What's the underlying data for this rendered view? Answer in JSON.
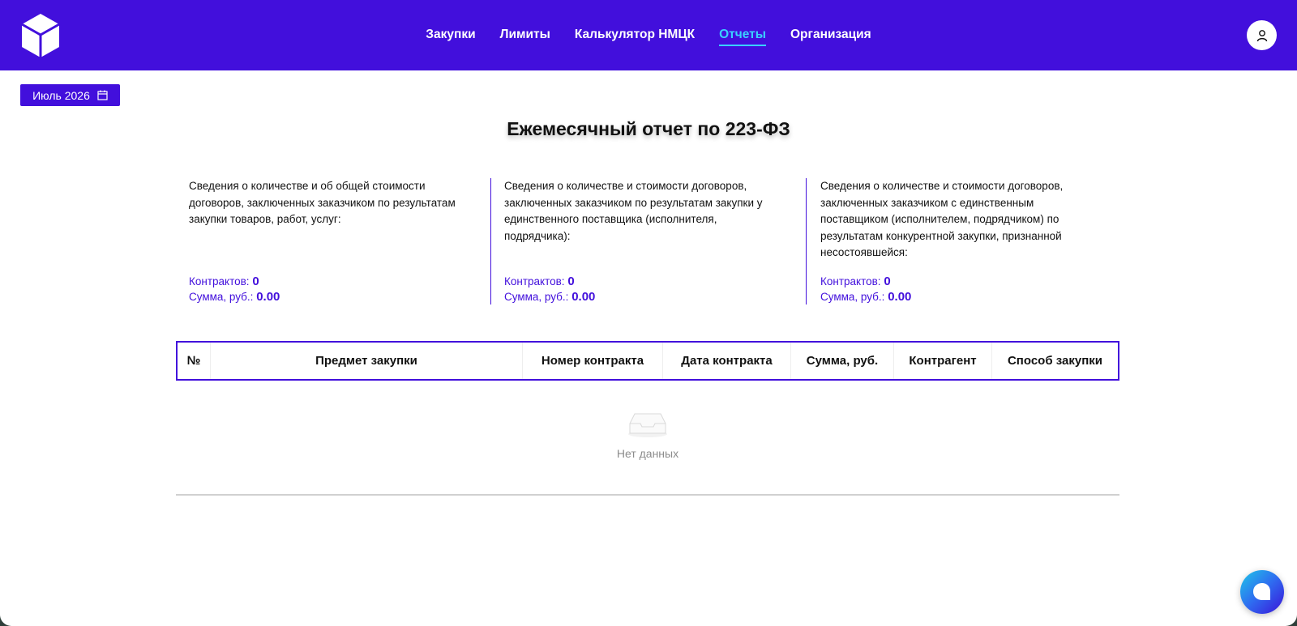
{
  "nav": {
    "items": [
      {
        "label": "Закупки"
      },
      {
        "label": "Лимиты"
      },
      {
        "label": "Калькулятор НМЦК"
      },
      {
        "label": "Отчеты"
      },
      {
        "label": "Организация"
      }
    ],
    "active_index": 3
  },
  "date_picker": {
    "value": "Июль 2026",
    "icon": "calendar-icon"
  },
  "page_title": "Ежемесячный отчет по 223-ФЗ",
  "stats": [
    {
      "description": "Сведения о количестве и об общей стоимости договоров, заключенных заказчиком по результатам закупки товаров, работ, услуг:",
      "contracts_label": "Контрактов:",
      "contracts_value": "0",
      "sum_label": "Сумма, руб.:",
      "sum_value": "0.00"
    },
    {
      "description": "Сведения о количестве и стоимости договоров, заключенных заказчиком по результатам закупки у единственного поставщика (исполнителя, подрядчика):",
      "contracts_label": "Контрактов:",
      "contracts_value": "0",
      "sum_label": "Сумма, руб.:",
      "sum_value": "0.00"
    },
    {
      "description": "Сведения о количестве и стоимости договоров, заключенных заказчиком с единственным поставщиком (исполнителем, подрядчиком) по результатам конкурентной закупки, признанной несостоявшейся:",
      "contracts_label": "Контрактов:",
      "contracts_value": "0",
      "sum_label": "Сумма, руб.:",
      "sum_value": "0.00"
    }
  ],
  "table": {
    "columns": [
      "№",
      "Предмет закупки",
      "Номер контракта",
      "Дата контракта",
      "Сумма, руб.",
      "Контрагент",
      "Способ закупки"
    ],
    "empty_text": "Нет данных"
  },
  "colors": {
    "brand": "#420fdc",
    "active_nav": "#3ad0ff"
  }
}
